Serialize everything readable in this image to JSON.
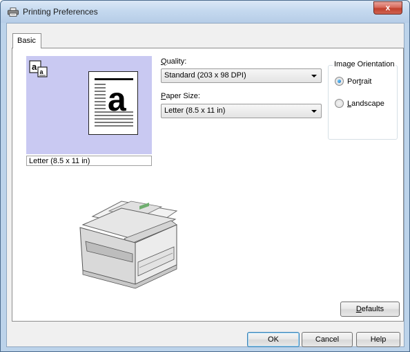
{
  "window": {
    "title": "Printing Preferences",
    "close_label": "x"
  },
  "tabs": [
    {
      "label": "Basic",
      "selected": true
    }
  ],
  "preview": {
    "page_letter": "a",
    "paper_label": "Letter (8.5 x 11 in)",
    "background_color": "#c9c9f2"
  },
  "quality": {
    "label_key": "Q",
    "label_rest": "uality:",
    "value": "Standard (203 x 98 DPI)"
  },
  "paper_size": {
    "label_key": "P",
    "label_rest": "aper Size:",
    "value": "Letter (8.5 x 11 in)"
  },
  "orientation": {
    "title": "Image Orientation",
    "options": [
      {
        "label_pre": "Por",
        "label_key": "t",
        "label_post": "rait",
        "selected": true
      },
      {
        "label_pre": "",
        "label_key": "L",
        "label_post": "andscape",
        "selected": false
      }
    ]
  },
  "buttons": {
    "defaults_key": "D",
    "defaults_rest": "efaults",
    "ok": "OK",
    "cancel": "Cancel",
    "help": "Help"
  }
}
